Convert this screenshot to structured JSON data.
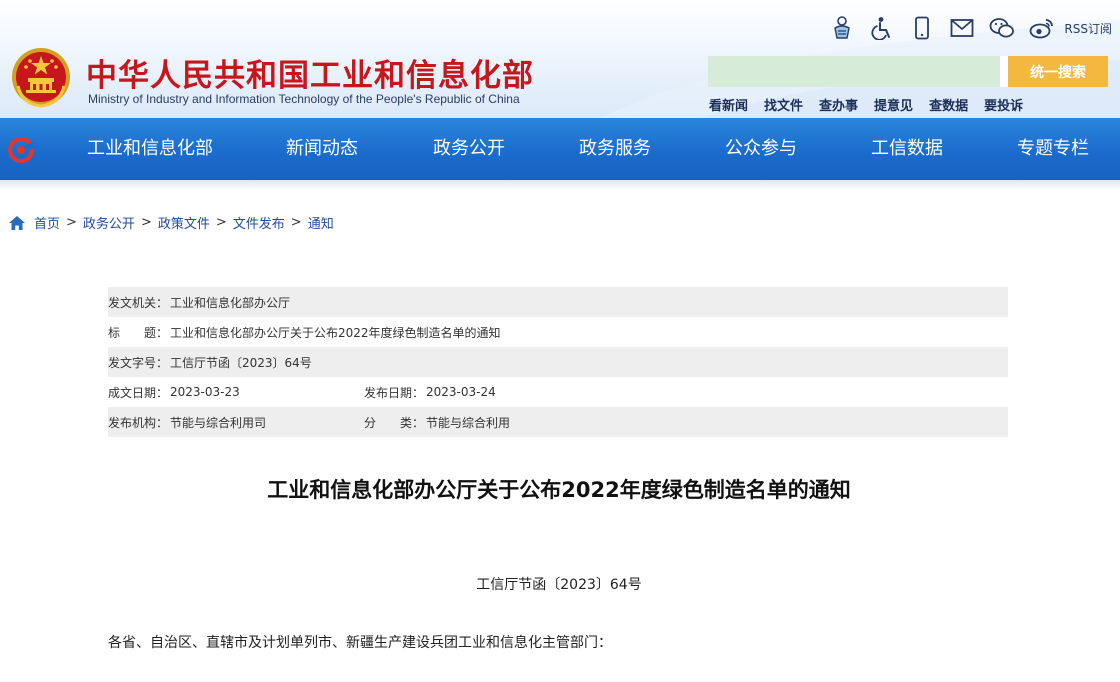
{
  "header": {
    "site_title": "中华人民共和国工业和信息化部",
    "site_subtitle": "Ministry of Industry and Information Technology of the People's Republic of China",
    "tools": [
      {
        "icon": "elder-mode-icon"
      },
      {
        "icon": "accessibility-icon"
      },
      {
        "icon": "mobile-icon"
      },
      {
        "icon": "mail-icon"
      },
      {
        "icon": "wechat-icon"
      },
      {
        "icon": "weibo-icon"
      }
    ],
    "rss_label": "RSS订阅",
    "search": {
      "placeholder": "",
      "button_label": "统一搜索"
    },
    "quick_links": [
      "看新闻",
      "找文件",
      "查办事",
      "提意见",
      "查数据",
      "要投诉"
    ],
    "colors": {
      "title_red": "#c8161d",
      "nav_blue": "#1b6ccd",
      "search_green": "#d6ecd9",
      "search_button": "#f4b73f"
    }
  },
  "nav": {
    "items": [
      "工业和信息化部",
      "新闻动态",
      "政务公开",
      "政务服务",
      "公众参与",
      "工信数据",
      "专题专栏"
    ]
  },
  "breadcrumb": {
    "items": [
      "首页",
      "政务公开",
      "政策文件",
      "文件发布",
      "通知"
    ],
    "separator": ">"
  },
  "meta": {
    "issuer_label": "发文机关：",
    "issuer": "工业和信息化部办公厅",
    "title_label": "标　　题：",
    "title": "工业和信息化部办公厅关于公布2022年度绿色制造名单的通知",
    "doc_no_label": "发文字号：",
    "doc_no": "工信厅节函〔2023〕64号",
    "written_label": "成文日期：",
    "written_date": "2023-03-23",
    "published_label": "发布日期：",
    "published_date": "2023-03-24",
    "agency_label": "发布机构：",
    "agency": "节能与综合利用司",
    "category_label": "分　　类：",
    "category": "节能与综合利用"
  },
  "article": {
    "title": "工业和信息化部办公厅关于公布2022年度绿色制造名单的通知",
    "doc_number": "工信厅节函〔2023〕64号",
    "salutation": "各省、自治区、直辖市及计划单列市、新疆生产建设兵团工业和信息化主管部门："
  }
}
